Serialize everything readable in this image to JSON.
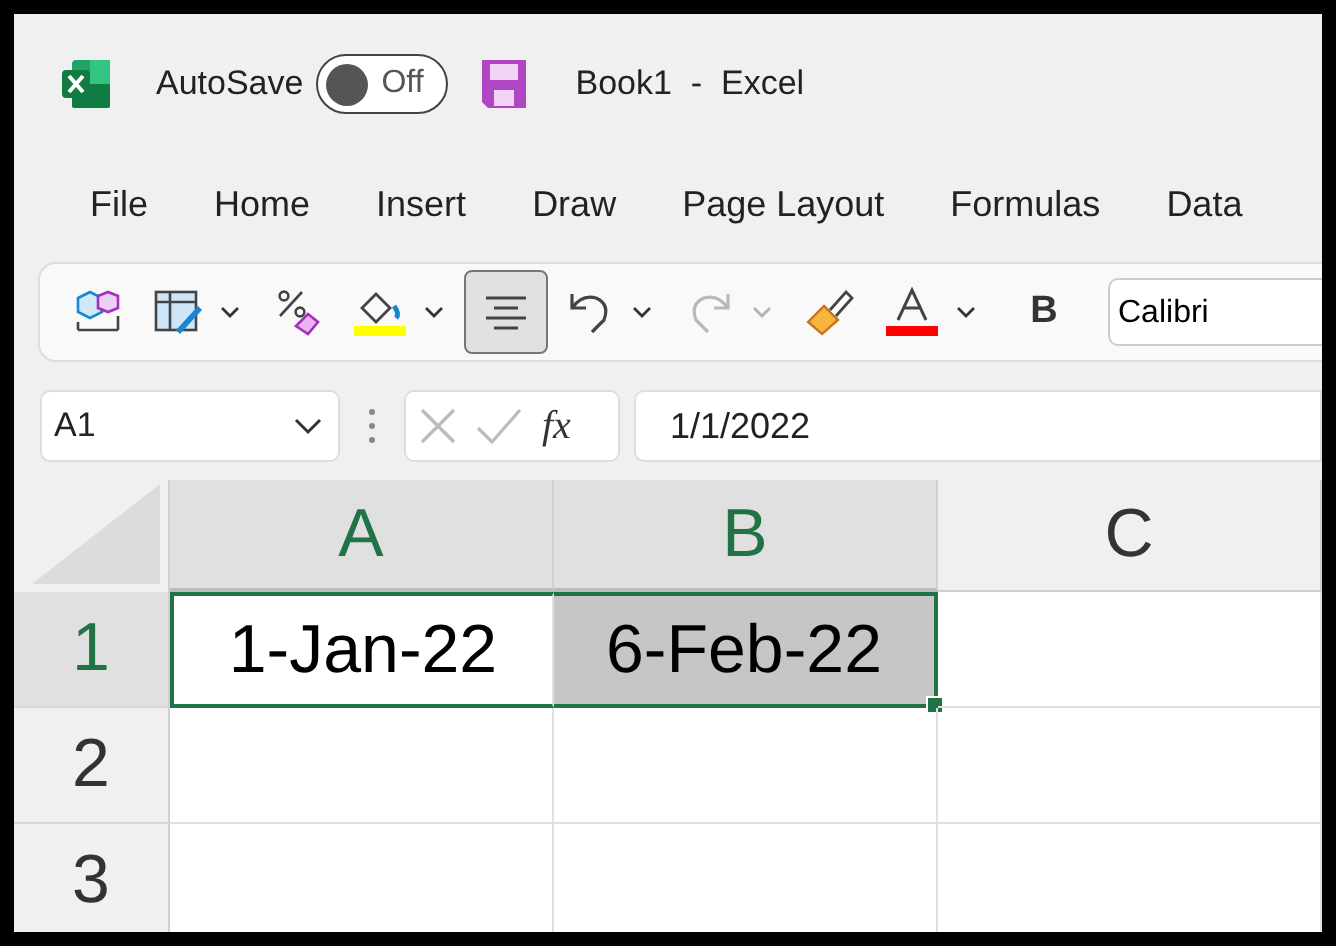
{
  "title_bar": {
    "autosave_label": "AutoSave",
    "autosave": {
      "on": false,
      "label": "Off"
    },
    "title": "Book1  -  Excel"
  },
  "tabs": [
    {
      "label": "File",
      "selected": false
    },
    {
      "label": "Home",
      "selected": false
    },
    {
      "label": "Insert",
      "selected": false
    },
    {
      "label": "Draw",
      "selected": false
    },
    {
      "label": "Page Layout",
      "selected": false
    },
    {
      "label": "Formulas",
      "selected": false
    },
    {
      "label": "Data",
      "selected": false
    }
  ],
  "toolbar": [
    {
      "kind": "add-in",
      "pressed": false
    },
    {
      "kind": "format-table",
      "dropdown": true,
      "pressed": false
    },
    {
      "kind": "clear-format",
      "pressed": false
    },
    {
      "kind": "fill-color",
      "color": "#ffff00",
      "dropdown": true,
      "pressed": false
    },
    {
      "kind": "align-center",
      "pressed": true
    },
    {
      "kind": "undo",
      "dropdown": true,
      "disabled": false,
      "pressed": false
    },
    {
      "kind": "redo",
      "dropdown": true,
      "disabled": true,
      "pressed": false
    },
    {
      "kind": "format-painter",
      "pressed": false
    },
    {
      "kind": "font-color",
      "color": "#ff0000",
      "dropdown": true,
      "pressed": false
    },
    {
      "kind": "bold",
      "label": "B",
      "pressed": false
    },
    {
      "kind": "font-select",
      "value": "Calibri"
    }
  ],
  "formula_bar": {
    "name_box": "A1",
    "function_label": "fx",
    "formula": "1/1/2022"
  },
  "sheet": {
    "columns": [
      {
        "label": "A",
        "selected": true
      },
      {
        "label": "B",
        "selected": true
      },
      {
        "label": "C",
        "selected": false
      }
    ],
    "rows": [
      {
        "label": "1",
        "selected": true,
        "cells": [
          {
            "text": "1-Jan-22",
            "selected": true,
            "active": true
          },
          {
            "text": "6-Feb-22",
            "selected": true,
            "active": false
          },
          {
            "selected": false
          }
        ]
      },
      {
        "label": "2",
        "selected": false,
        "cells": [
          {
            "selected": false
          },
          {
            "selected": false
          },
          {
            "selected": false
          }
        ]
      },
      {
        "label": "3",
        "selected": false,
        "cells": [
          {
            "selected": false
          },
          {
            "selected": false
          },
          {
            "selected": false
          }
        ]
      }
    ]
  }
}
